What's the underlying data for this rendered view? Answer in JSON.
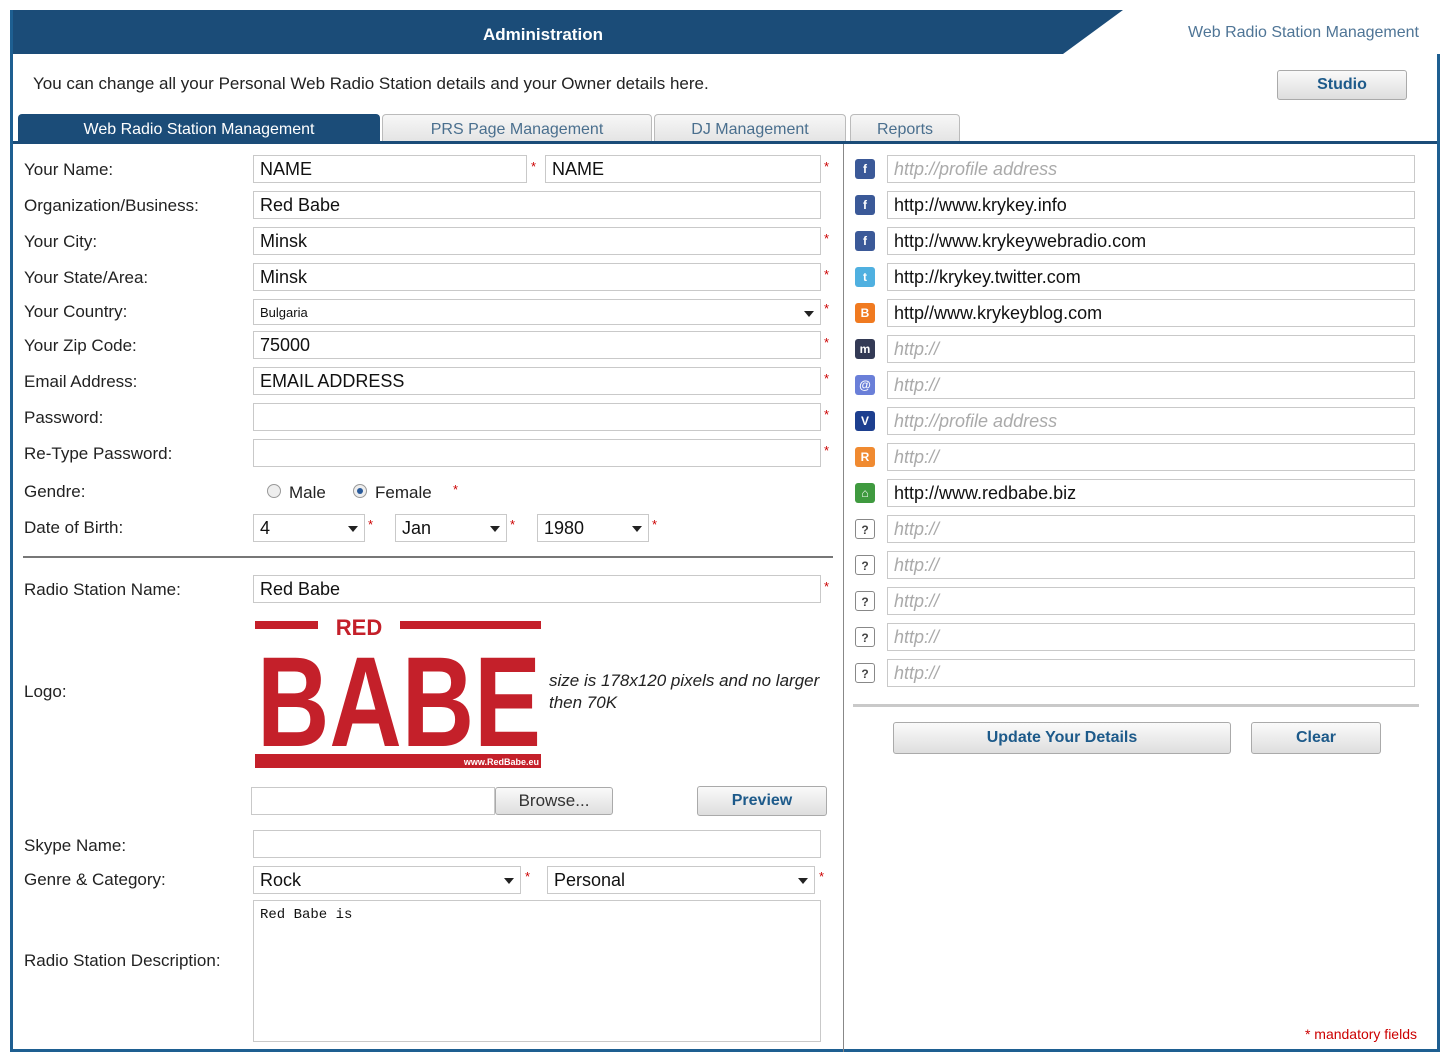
{
  "header": {
    "title": "Administration",
    "right_label": "Web Radio Station Management"
  },
  "intro": "You can change all your Personal Web Radio Station details and your Owner details here.",
  "studio_button": "Studio",
  "tabs": [
    "Web Radio Station Management",
    "PRS Page Management",
    "DJ Management",
    "Reports"
  ],
  "form": {
    "name_label": "Your Name:",
    "first_name": "NAME",
    "last_name": "NAME",
    "org_label": "Organization/Business:",
    "org": "Red Babe",
    "city_label": "Your City:",
    "city": "Minsk",
    "state_label": "Your State/Area:",
    "state": "Minsk",
    "country_label": "Your Country:",
    "country": "Bulgaria",
    "zip_label": "Your Zip Code:",
    "zip": "75000",
    "email_label": "Email Address:",
    "email": "EMAIL ADDRESS",
    "password_label": "Password:",
    "retype_label": "Re-Type Password:",
    "gender_label": "Gendre:",
    "male": "Male",
    "female": "Female",
    "dob_label": "Date of Birth:",
    "dob_day": "4",
    "dob_month": "Jan",
    "dob_year": "1980",
    "station_label": "Radio Station Name:",
    "station": "Red Babe",
    "logo_label": "Logo:",
    "logo_hint": "size is 178x120 pixels and no larger then 70K",
    "browse": "Browse...",
    "preview": "Preview",
    "skype_label": "Skype Name:",
    "genre_label": "Genre & Category:",
    "genre": "Rock",
    "category": "Personal",
    "desc_label": "Radio Station Description:",
    "desc": "Red Babe is"
  },
  "logo": {
    "top": "RED",
    "main": "BABE",
    "site": "www.RedBabe.eu"
  },
  "social": [
    {
      "icon": "facebook-icon",
      "glyph": "f",
      "color": "#3b5998",
      "value": "",
      "placeholder": "http://profile address"
    },
    {
      "icon": "facebook-icon",
      "glyph": "f",
      "color": "#3b5998",
      "value": "http://www.krykey.info",
      "placeholder": ""
    },
    {
      "icon": "facebook-icon",
      "glyph": "f",
      "color": "#3b5998",
      "value": "http://www.krykeywebradio.com",
      "placeholder": ""
    },
    {
      "icon": "twitter-icon",
      "glyph": "t",
      "color": "#4fb0e0",
      "value": "http://krykey.twitter.com",
      "placeholder": ""
    },
    {
      "icon": "blogger-icon",
      "glyph": "B",
      "color": "#f07a20",
      "value": "http//www.krykeyblog.com",
      "placeholder": ""
    },
    {
      "icon": "myspace-icon",
      "glyph": "m",
      "color": "#333a55",
      "value": "",
      "placeholder": "http://"
    },
    {
      "icon": "at-icon",
      "glyph": "@",
      "color": "#6a7fd8",
      "value": "",
      "placeholder": "http://"
    },
    {
      "icon": "vkontakte-icon",
      "glyph": "V",
      "color": "#1d3f8f",
      "value": "",
      "placeholder": "http://profile address"
    },
    {
      "icon": "rss-icon",
      "glyph": "R",
      "color": "#f08a30",
      "value": "",
      "placeholder": "http://"
    },
    {
      "icon": "home-icon",
      "glyph": "⌂",
      "color": "#3f9a3f",
      "value": "http://www.redbabe.biz",
      "placeholder": ""
    },
    {
      "icon": "question-icon",
      "glyph": "?",
      "color": "",
      "value": "",
      "placeholder": "http://"
    },
    {
      "icon": "question-icon",
      "glyph": "?",
      "color": "",
      "value": "",
      "placeholder": "http://"
    },
    {
      "icon": "question-icon",
      "glyph": "?",
      "color": "",
      "value": "",
      "placeholder": "http://"
    },
    {
      "icon": "question-icon",
      "glyph": "?",
      "color": "",
      "value": "",
      "placeholder": "http://"
    },
    {
      "icon": "question-icon",
      "glyph": "?",
      "color": "",
      "value": "",
      "placeholder": "http://"
    }
  ],
  "update_button": "Update Your Details",
  "clear_button": "Clear",
  "mandatory_note": "* mandatory fields"
}
